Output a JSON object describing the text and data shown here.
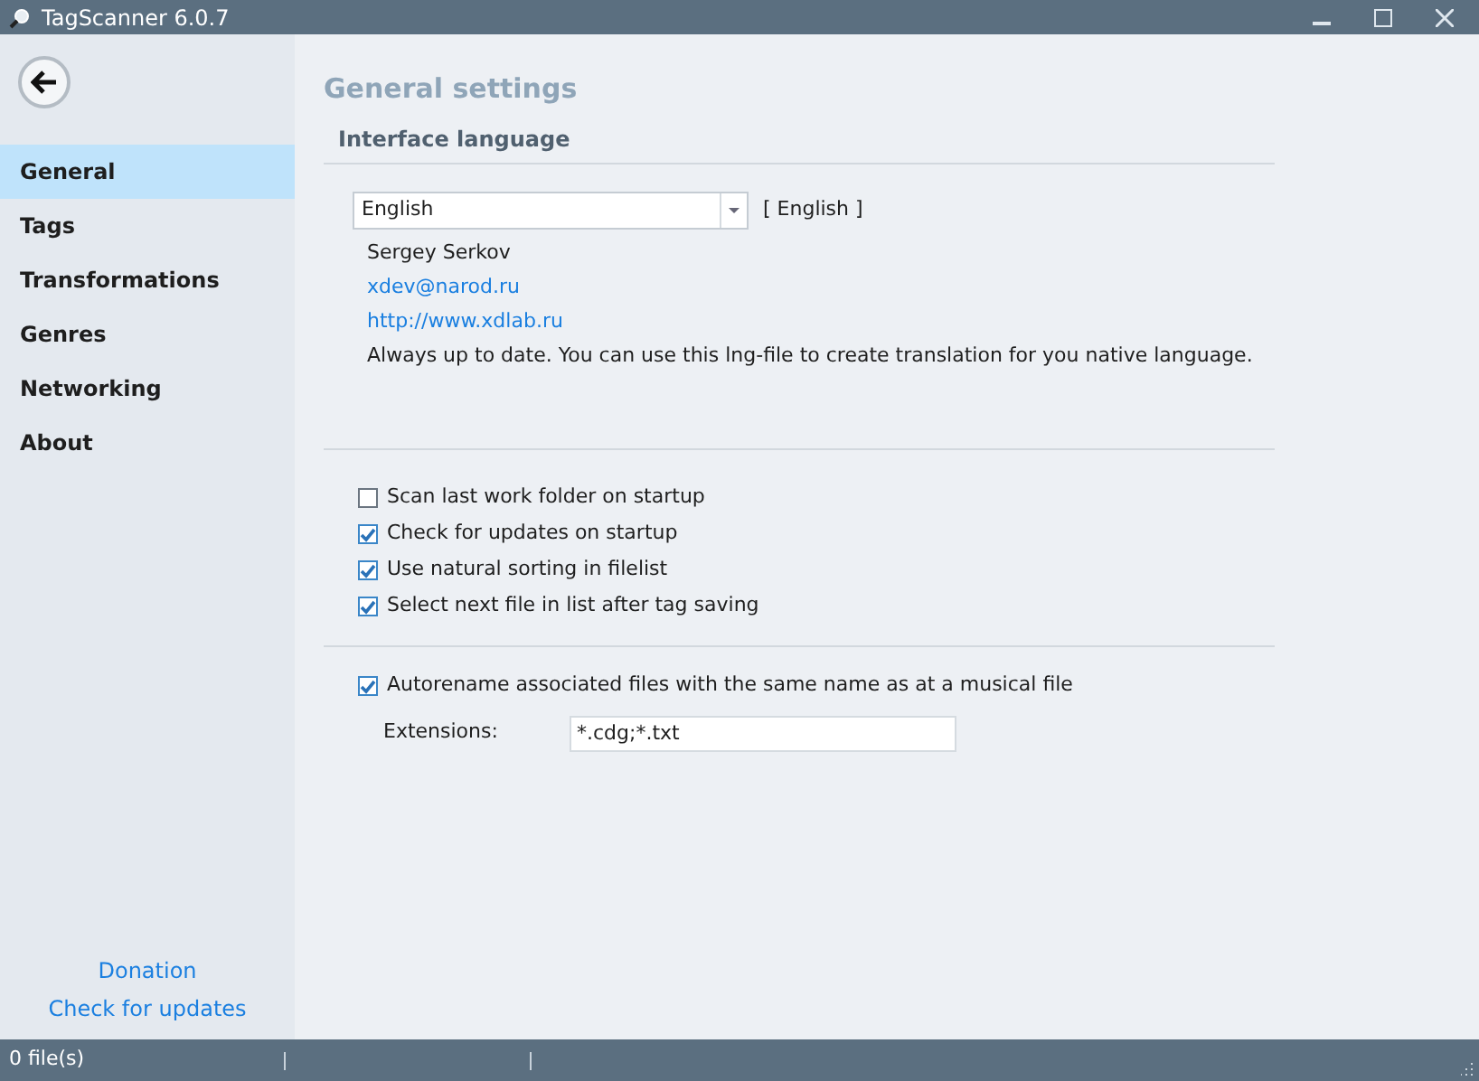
{
  "window": {
    "title": "TagScanner 6.0.7"
  },
  "sidebar": {
    "items": [
      {
        "label": "General",
        "selected": true
      },
      {
        "label": "Tags",
        "selected": false
      },
      {
        "label": "Transformations",
        "selected": false
      },
      {
        "label": "Genres",
        "selected": false
      },
      {
        "label": "Networking",
        "selected": false
      },
      {
        "label": "About",
        "selected": false
      }
    ],
    "links": [
      "Donation",
      "Check for updates"
    ]
  },
  "content": {
    "title": "General settings",
    "section": "Interface language",
    "language": {
      "value": "English",
      "tag": "[ English ]"
    },
    "author": "Sergey Serkov",
    "email": "xdev@narod.ru",
    "website": "http://www.xdlab.ru",
    "note": "Always up to date. You can use this lng-file to create translation for you native language.",
    "options": [
      {
        "label": "Scan last work folder on startup",
        "checked": false
      },
      {
        "label": "Check for updates on startup",
        "checked": true
      },
      {
        "label": "Use natural sorting in filelist",
        "checked": true
      },
      {
        "label": "Select next file in list after tag saving",
        "checked": true
      }
    ],
    "autorename": {
      "label": "Autorename associated files with the same name as at a musical file",
      "checked": true
    },
    "extensions": {
      "label": "Extensions:",
      "value": "*.cdg;*.txt"
    }
  },
  "status_bar": {
    "file_count": "0 file(s)"
  }
}
